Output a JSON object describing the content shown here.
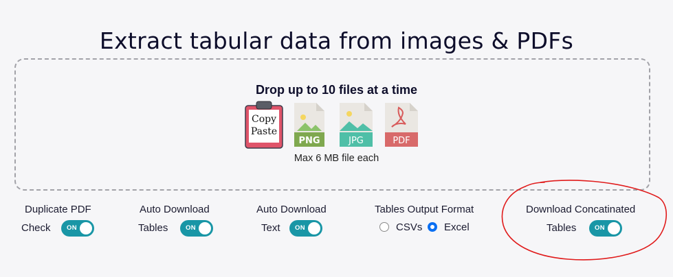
{
  "page": {
    "title": "Extract tabular data from images & PDFs"
  },
  "dropzone": {
    "heading": "Drop up to 10 files at a time",
    "note": "Max 6 MB file each",
    "icons": [
      {
        "name": "copy-paste-clipboard-icon",
        "line1": "Copy",
        "line2": "Paste"
      },
      {
        "name": "png-file-icon",
        "label": "PNG",
        "color": "#7fa84f"
      },
      {
        "name": "jpg-file-icon",
        "label": "JPG",
        "color": "#4fbfa7"
      },
      {
        "name": "pdf-file-icon",
        "label": "PDF",
        "color": "#d86a6a"
      }
    ]
  },
  "options": {
    "duplicate_pdf": {
      "label_top": "Duplicate PDF",
      "label_side": "Check",
      "toggle": "ON"
    },
    "auto_download_tables": {
      "label_top": "Auto Download",
      "label_side": "Tables",
      "toggle": "ON"
    },
    "auto_download_text": {
      "label_top": "Auto Download",
      "label_side": "Text",
      "toggle": "ON"
    },
    "output_format": {
      "label_top": "Tables Output Format",
      "csvs": "CSVs",
      "excel": "Excel",
      "selected": "Excel"
    },
    "download_concat": {
      "label_top": "Download Concatinated",
      "label_side": "Tables",
      "toggle": "ON"
    }
  },
  "colors": {
    "toggle_on": "#1996a6",
    "radio_selected": "#0a6ff2",
    "annotation": "#e01b1b"
  }
}
